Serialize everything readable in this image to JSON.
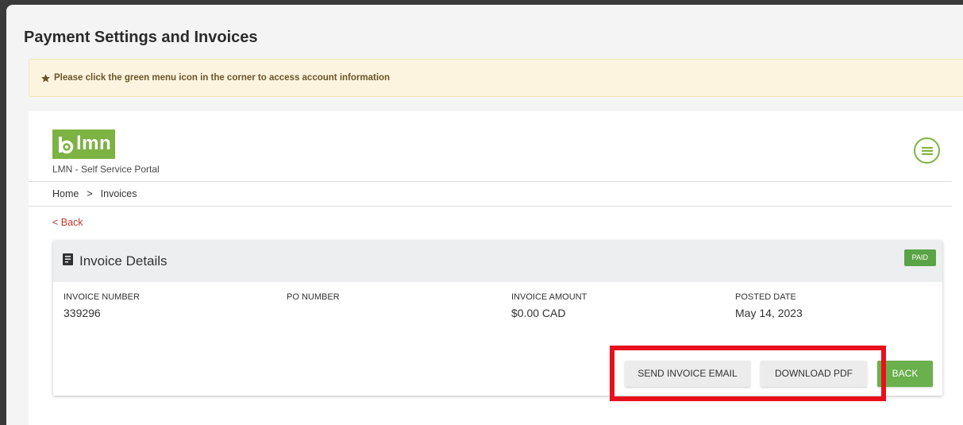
{
  "header": {
    "title": "Payment Settings and Invoices"
  },
  "notice": {
    "text": "Please click the green menu icon in the corner to access account information",
    "icon": "star-icon"
  },
  "portal": {
    "logo_text": "lmn",
    "label": "LMN - Self Service Portal",
    "menu_icon": "hamburger-circle-icon"
  },
  "breadcrumb": {
    "items": [
      "Home",
      ">",
      "Invoices"
    ]
  },
  "back_link": "< Back",
  "invoice": {
    "title": "Invoice Details",
    "status": "PAID",
    "fields": [
      {
        "label": "INVOICE NUMBER",
        "value": "339296"
      },
      {
        "label": "PO NUMBER",
        "value": ""
      },
      {
        "label": "INVOICE AMOUNT",
        "value": "$0.00 CAD"
      },
      {
        "label": "POSTED DATE",
        "value": "May 14, 2023"
      }
    ],
    "buttons": {
      "send_email": "SEND INVOICE EMAIL",
      "download_pdf": "DOWNLOAD PDF",
      "back": "BACK"
    }
  },
  "colors": {
    "accent": "#7cb342",
    "paid": "#5aa447",
    "highlight": "#e8101c",
    "notice_bg": "#fdf4e0"
  }
}
